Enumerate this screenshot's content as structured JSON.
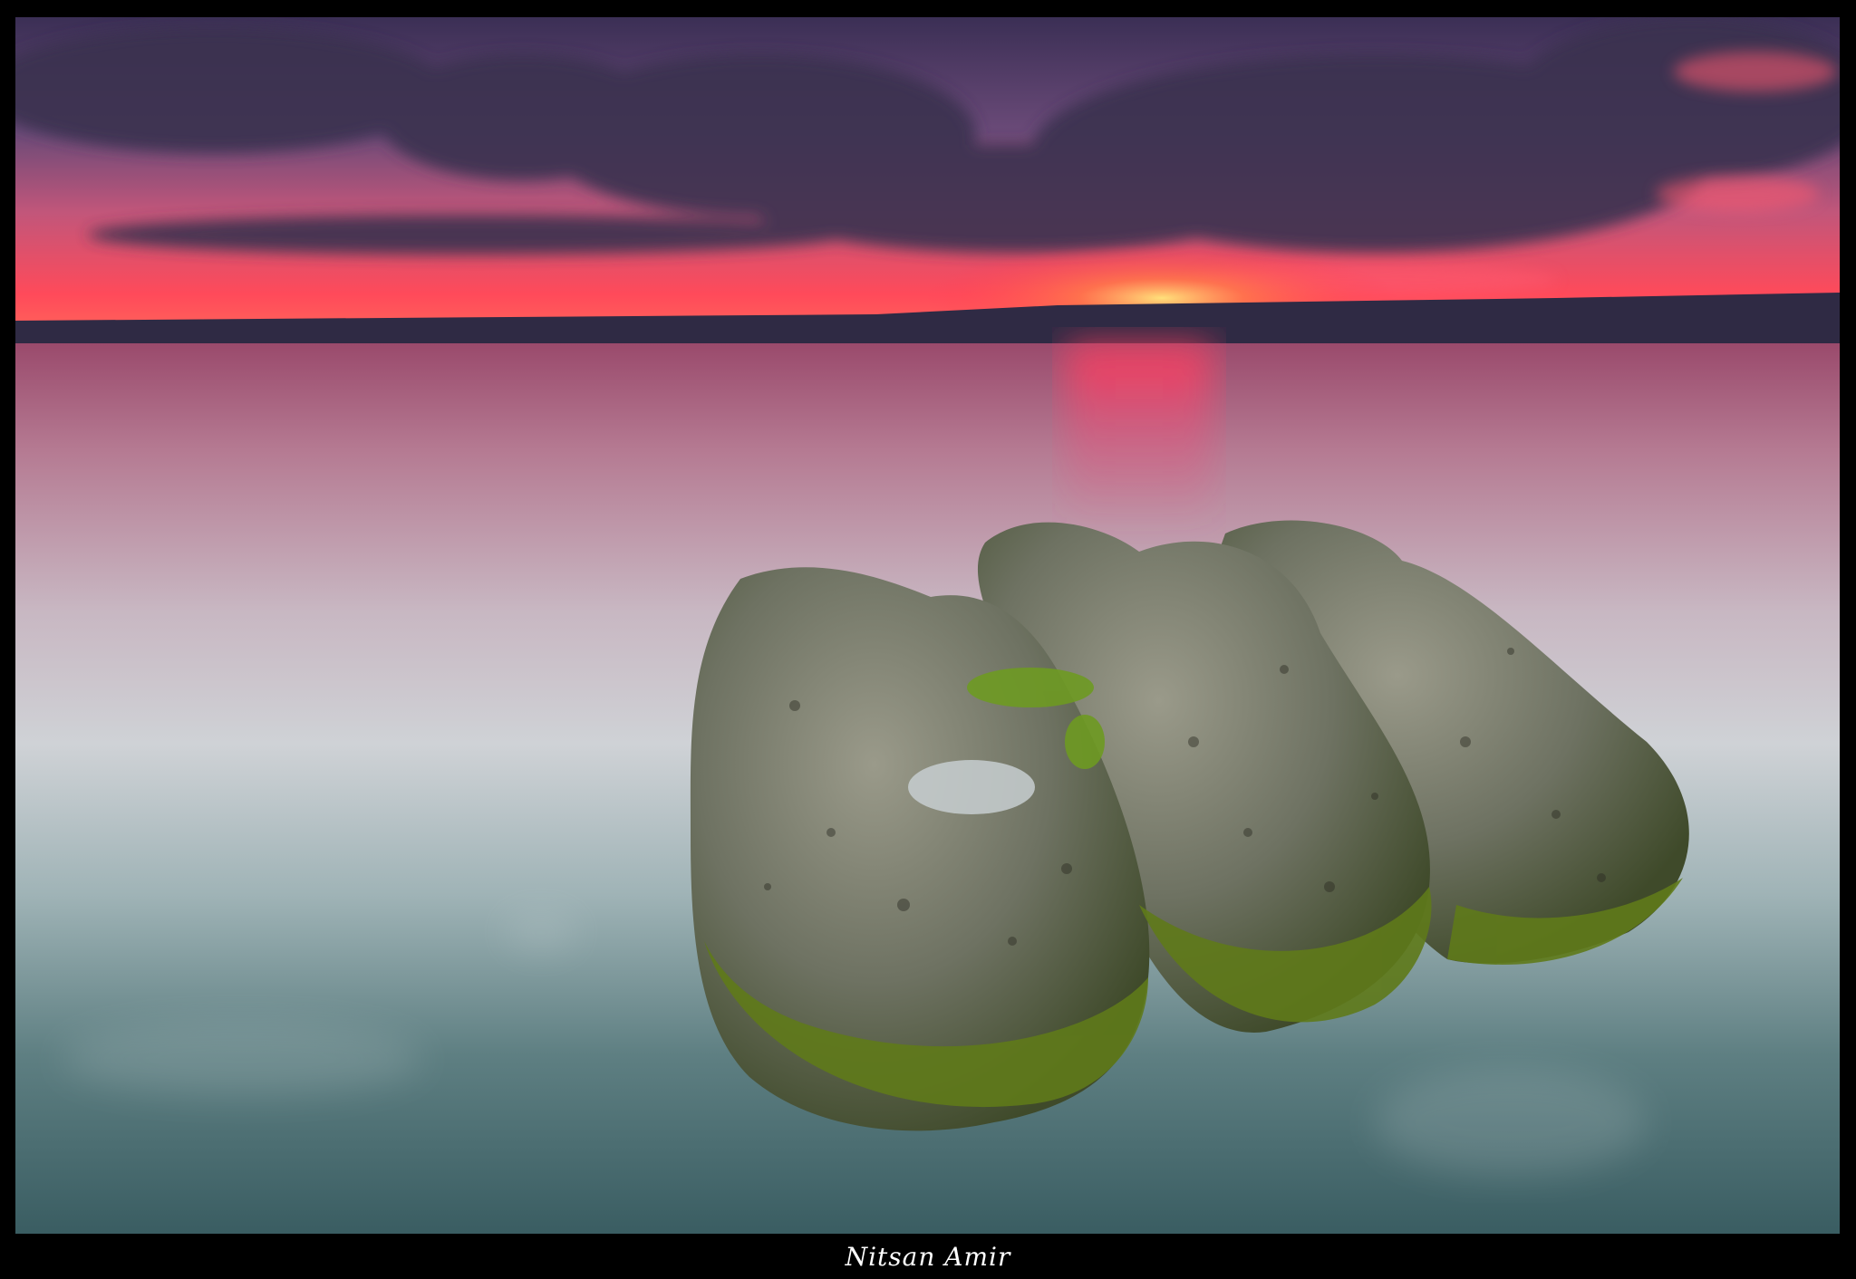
{
  "photo": {
    "subject": "three-mossy-rocks-in-calm-lake-at-sunset",
    "colors": {
      "frame": "#000000",
      "sky_top": "#3a2d52",
      "sky_glow": "#ff3a55",
      "sun": "#ffc24a",
      "mountains": "#2e2a44",
      "water_reflection": "#e0506e",
      "water_mid": "#a8aeb8",
      "water_bottom": "#3f6468",
      "rock": "#6f7468",
      "moss": "#7a8a2a"
    }
  },
  "signature": {
    "text": "Nitsan Amir"
  }
}
